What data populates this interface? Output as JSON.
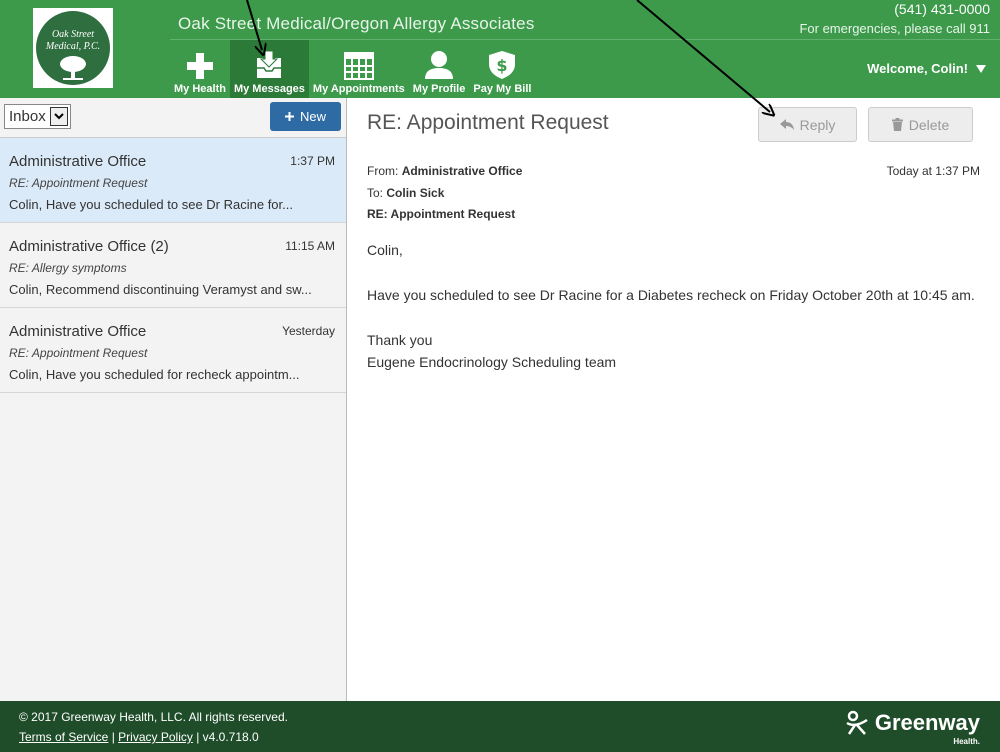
{
  "header": {
    "practice_name": "Oak Street Medical/Oregon Allergy Associates",
    "phone": "(541) 431-0000",
    "emergency": "For emergencies, please call 911",
    "welcome": "Welcome, Colin!",
    "logo_text_line1": "Oak Street",
    "logo_text_line2": "Medical, P.C.",
    "brand_color": "#3c9a4a"
  },
  "nav": {
    "items": [
      {
        "label": "My Health",
        "icon": "plus-icon",
        "active": false
      },
      {
        "label": "My Messages",
        "icon": "inbox-icon",
        "active": true
      },
      {
        "label": "My Appointments",
        "icon": "calendar-icon",
        "active": false
      },
      {
        "label": "My Profile",
        "icon": "user-icon",
        "active": false
      },
      {
        "label": "Pay My Bill",
        "icon": "dollar-shield-icon",
        "active": false
      }
    ]
  },
  "sidebar": {
    "folder": "Inbox",
    "new_label": "New",
    "messages": [
      {
        "sender": "Administrative Office",
        "time": "1:37 PM",
        "subject": "RE: Appointment Request",
        "preview": "Colin, Have you scheduled to see Dr Racine for...",
        "selected": true
      },
      {
        "sender": "Administrative Office (2)",
        "time": "11:15 AM",
        "subject": "RE: Allergy symptoms",
        "preview": "Colin, Recommend discontinuing Veramyst and sw...",
        "selected": false
      },
      {
        "sender": "Administrative Office",
        "time": "Yesterday",
        "subject": "RE: Appointment Request",
        "preview": "Colin, Have you scheduled for recheck appointm...",
        "selected": false
      }
    ]
  },
  "message": {
    "title": "RE: Appointment Request",
    "reply_label": "Reply",
    "delete_label": "Delete",
    "from_label": "From:",
    "from": "Administrative Office",
    "to_label": "To:",
    "to": "Colin Sick",
    "subject": "RE: Appointment Request",
    "date": "Today at 1:37 PM",
    "body": {
      "greeting": "Colin,",
      "paragraph": "Have you scheduled to see Dr Racine for a Diabetes recheck on Friday October 20th at 10:45 am.",
      "closing": "Thank you",
      "signature": "Eugene Endocrinology Scheduling team"
    }
  },
  "footer": {
    "copyright": "© 2017 Greenway Health, LLC. All rights reserved.",
    "terms": "Terms of Service",
    "separator": "|",
    "privacy": "Privacy Policy",
    "version": "| v4.0.718.0",
    "brand": "Greenway",
    "brand_sub": "Health."
  }
}
